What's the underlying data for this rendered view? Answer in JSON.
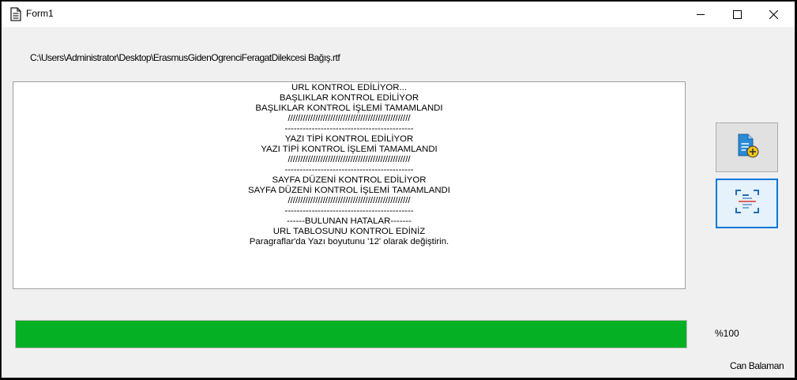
{
  "window": {
    "title": "Form1",
    "icon": "document-icon"
  },
  "title_controls": {
    "minimize": "minimize-icon",
    "maximize": "maximize-icon",
    "close": "close-icon"
  },
  "file_path": "C:\\Users\\Administrator\\Desktop\\ErasmusGidenOgrenciFeragatDilekcesi Bağış.rtf",
  "log": [
    "URL KONTROL EDİLİYOR...",
    "BAŞLIKLAR KONTROL EDİLİYOR",
    "BAŞLIKLAR KONTROL İŞLEMİ TAMAMLANDI",
    "/////////////////////////////////////////////////",
    "-------------------------------------------",
    "YAZI TİPİ KONTROL EDİLİYOR",
    "YAZI TİPİ KONTROL İŞLEMİ TAMAMLANDI",
    "/////////////////////////////////////////////////",
    "-------------------------------------------",
    "SAYFA DÜZENİ KONTROL EDİLİYOR",
    "SAYFA DÜZENİ KONTROL İŞLEMİ TAMAMLANDI",
    "/////////////////////////////////////////////////",
    "-------------------------------------------",
    "------BULUNAN HATALAR-------",
    "URL TABLOSUNU KONTROL EDİNİZ",
    "Paragraflar'da Yazı boyutunu '12' olarak değiştirin."
  ],
  "buttons": {
    "add_file_icon": "add-document-icon",
    "scan_icon": "scan-document-icon"
  },
  "progress": {
    "value": 100,
    "label": "%100",
    "color": "#06b025"
  },
  "author": "Can Balaman"
}
